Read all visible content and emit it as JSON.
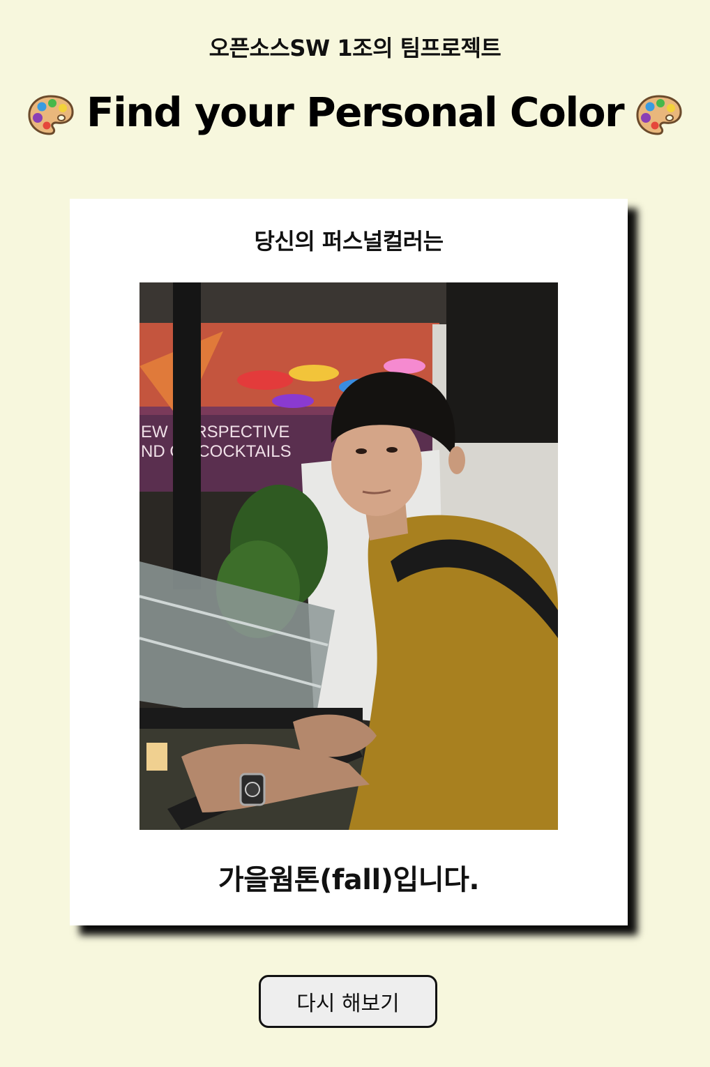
{
  "header": {
    "subtitle": "오픈소스SW 1조의 팀프로젝트",
    "title": "Find your Personal Color",
    "title_icon": "artist-palette-icon"
  },
  "result_card": {
    "heading": "당신의 퍼스널컬러는",
    "photo": {
      "sign_text_line1": "EW PERSPECTIVE",
      "sign_text_line2": "ND OF COCKTAILS",
      "shirt_color": "#a8801f"
    },
    "result_text": "가을웜톤(fall)입니다."
  },
  "actions": {
    "retry_label": "다시 해보기"
  },
  "colors": {
    "page_background": "#f7f7dd",
    "card_background": "#ffffff",
    "button_background": "#eeeeee"
  }
}
